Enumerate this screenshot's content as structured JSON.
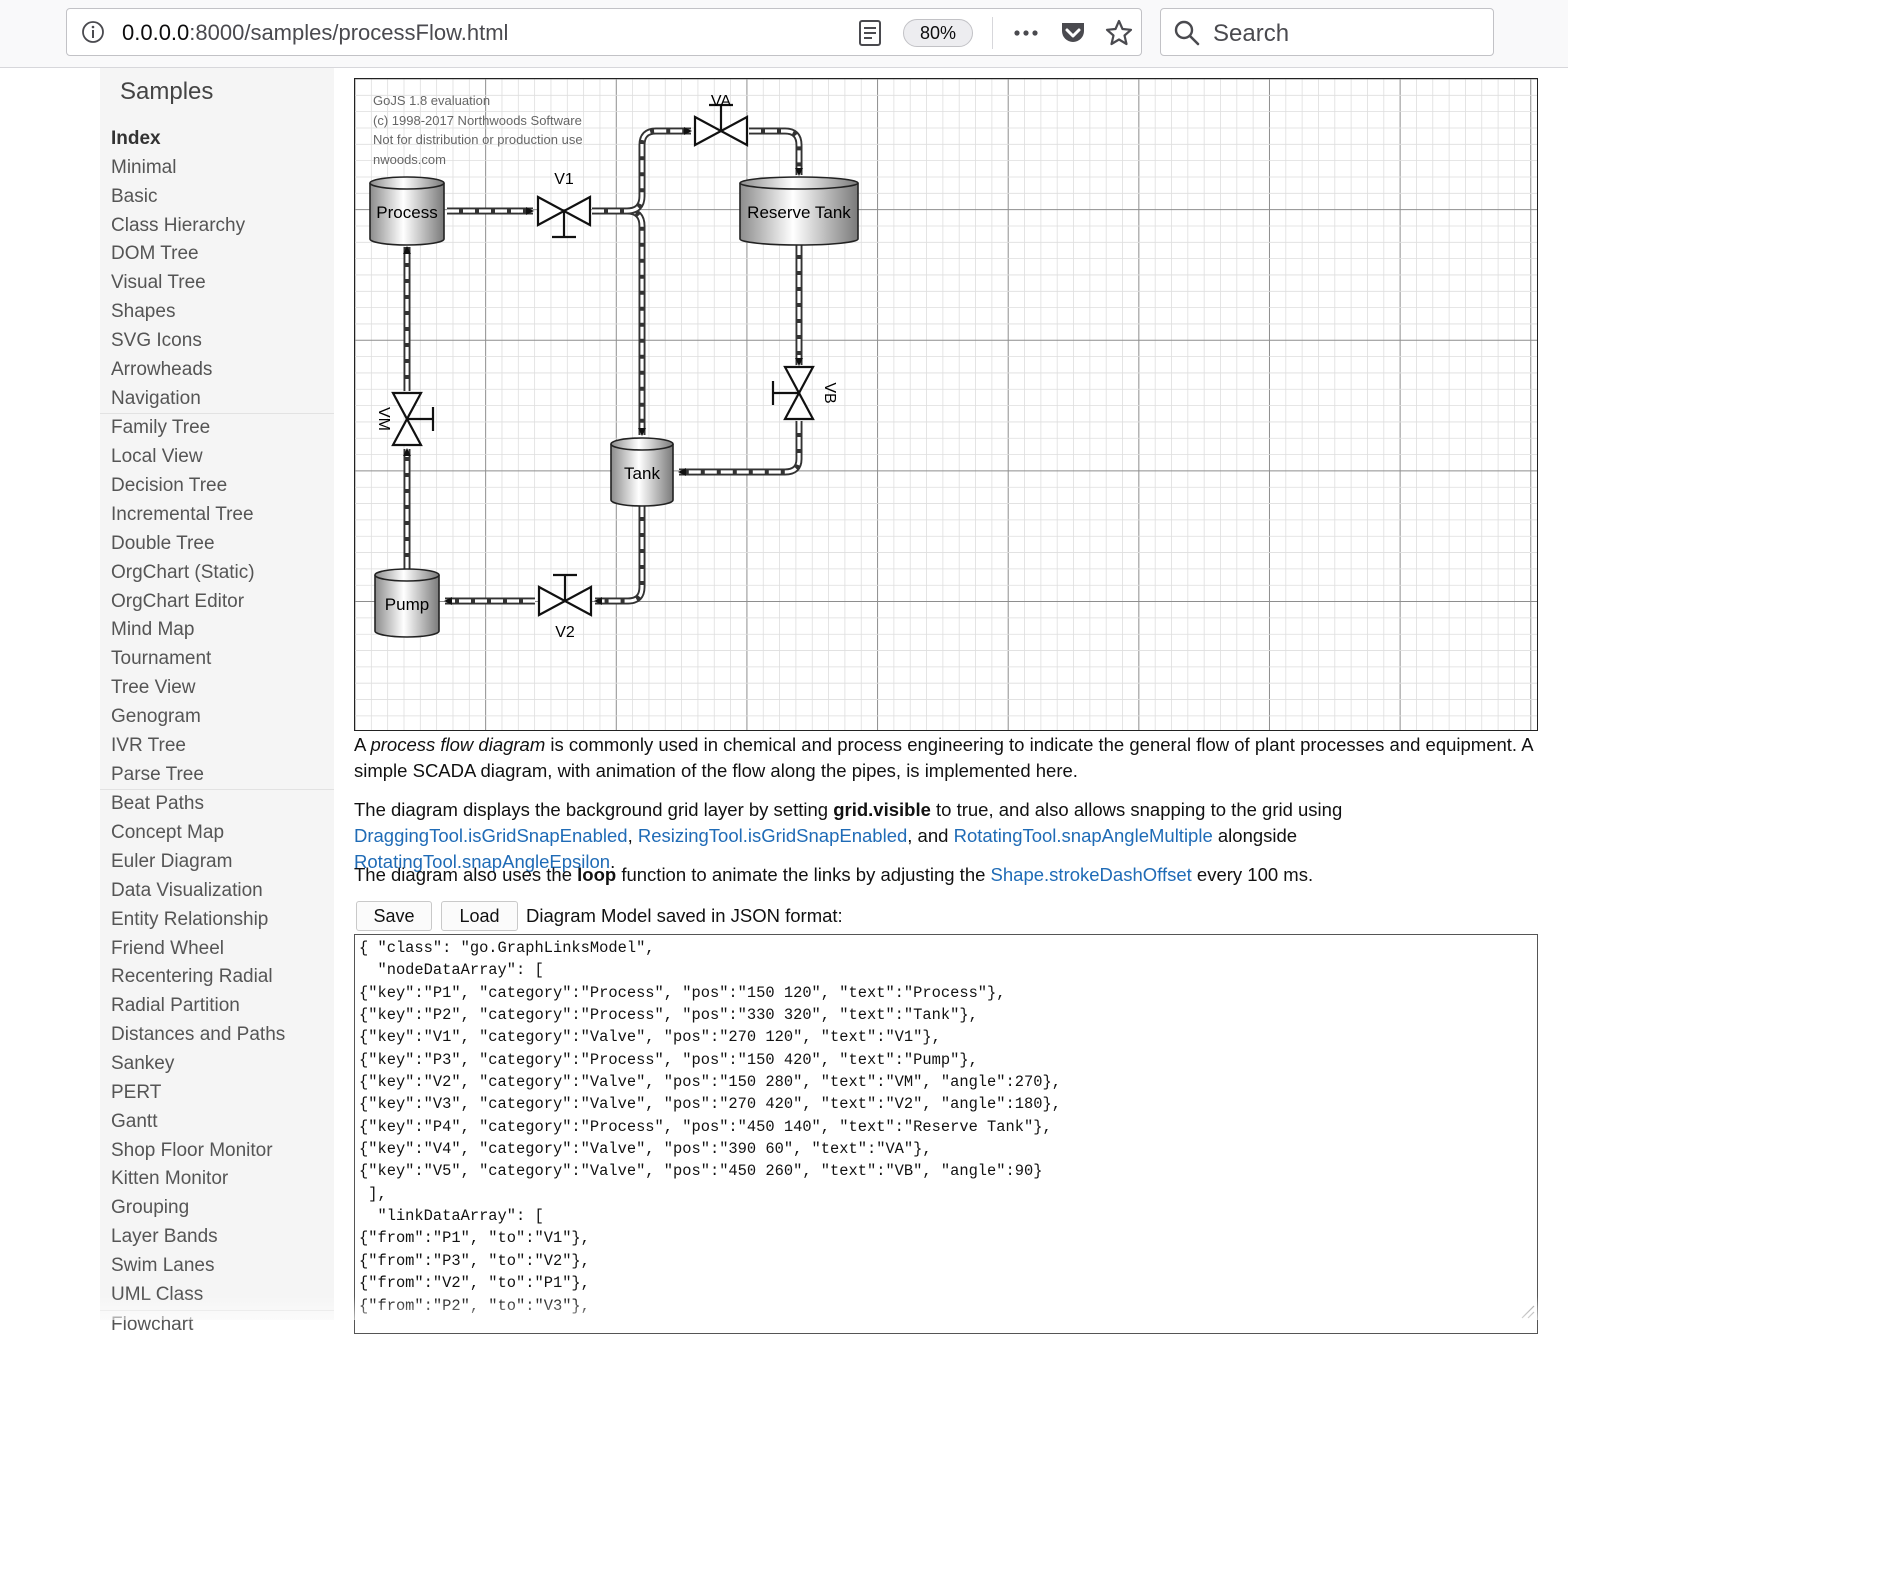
{
  "browser": {
    "url_host": "0.0.0.0",
    "url_path": ":8000/samples/processFlow.html",
    "zoom": "80%",
    "search_placeholder": "Search"
  },
  "sidebar": {
    "title": "Samples",
    "items": [
      {
        "label": "Index",
        "active": true
      },
      {
        "label": "Minimal"
      },
      {
        "label": "Basic"
      },
      {
        "label": "Class Hierarchy"
      },
      {
        "label": "DOM Tree"
      },
      {
        "label": "Visual Tree"
      },
      {
        "label": "Shapes"
      },
      {
        "label": "SVG Icons"
      },
      {
        "label": "Arrowheads"
      },
      {
        "label": "Navigation"
      },
      {
        "label": "Family Tree",
        "separator": true
      },
      {
        "label": "Local View"
      },
      {
        "label": "Decision Tree"
      },
      {
        "label": "Incremental Tree"
      },
      {
        "label": "Double Tree"
      },
      {
        "label": "OrgChart (Static)"
      },
      {
        "label": "OrgChart Editor"
      },
      {
        "label": "Mind Map"
      },
      {
        "label": "Tournament"
      },
      {
        "label": "Tree View"
      },
      {
        "label": "Genogram"
      },
      {
        "label": "IVR Tree"
      },
      {
        "label": "Parse Tree"
      },
      {
        "label": "Beat Paths",
        "separator": true
      },
      {
        "label": "Concept Map"
      },
      {
        "label": "Euler Diagram"
      },
      {
        "label": "Data Visualization"
      },
      {
        "label": "Entity Relationship"
      },
      {
        "label": "Friend Wheel"
      },
      {
        "label": "Recentering Radial"
      },
      {
        "label": "Radial Partition"
      },
      {
        "label": "Distances and Paths"
      },
      {
        "label": "Sankey"
      },
      {
        "label": "PERT"
      },
      {
        "label": "Gantt"
      },
      {
        "label": "Shop Floor Monitor"
      },
      {
        "label": "Kitten Monitor"
      },
      {
        "label": "Grouping"
      },
      {
        "label": "Layer Bands"
      },
      {
        "label": "Swim Lanes"
      },
      {
        "label": "UML Class"
      },
      {
        "label": "Flowchart",
        "separator": true
      }
    ]
  },
  "diagram": {
    "watermark": [
      "GoJS 1.8 evaluation",
      "(c) 1998-2017 Northwoods Software",
      "Not for distribution or production use",
      "nwoods.com"
    ],
    "nodes": {
      "process": "Process",
      "reserve_tank": "Reserve Tank",
      "tank": "Tank",
      "pump": "Pump",
      "v1": "V1",
      "v2": "V2",
      "va": "VA",
      "vb": "VB",
      "vm": "VM"
    }
  },
  "description": {
    "p1_a": "A ",
    "p1_italic": "process flow diagram",
    "p1_b": " is commonly used in chemical and process engineering to indicate the general flow of plant processes and equipment. A simple SCADA diagram, with animation of the flow along the pipes, is implemented here.",
    "p2_a": "The diagram displays the background grid layer by setting ",
    "p2_bold": "grid.visible",
    "p2_b": " to true, and also allows snapping to the grid using",
    "p2_link1": "DraggingTool.isGridSnapEnabled",
    "p2_c": ", ",
    "p2_link2": "ResizingTool.isGridSnapEnabled",
    "p2_d": ", and ",
    "p2_link3": "RotatingTool.snapAngleMultiple",
    "p2_e": " alongside ",
    "p2_link4": "RotatingTool.snapAngleEpsilon",
    "p2_f": ".",
    "p3_a": "The diagram also uses the ",
    "p3_bold": "loop",
    "p3_b": " function to animate the links by adjusting the ",
    "p3_link": "Shape.strokeDashOffset",
    "p3_c": " every 100 ms."
  },
  "controls": {
    "save_label": "Save",
    "load_label": "Load",
    "json_label": "Diagram Model saved in JSON format:"
  },
  "json_text": [
    "{ \"class\": \"go.GraphLinksModel\",",
    "  \"nodeDataArray\": [",
    "{\"key\":\"P1\", \"category\":\"Process\", \"pos\":\"150 120\", \"text\":\"Process\"},",
    "{\"key\":\"P2\", \"category\":\"Process\", \"pos\":\"330 320\", \"text\":\"Tank\"},",
    "{\"key\":\"V1\", \"category\":\"Valve\", \"pos\":\"270 120\", \"text\":\"V1\"},",
    "{\"key\":\"P3\", \"category\":\"Process\", \"pos\":\"150 420\", \"text\":\"Pump\"},",
    "{\"key\":\"V2\", \"category\":\"Valve\", \"pos\":\"150 280\", \"text\":\"VM\", \"angle\":270},",
    "{\"key\":\"V3\", \"category\":\"Valve\", \"pos\":\"270 420\", \"text\":\"V2\", \"angle\":180},",
    "{\"key\":\"P4\", \"category\":\"Process\", \"pos\":\"450 140\", \"text\":\"Reserve Tank\"},",
    "{\"key\":\"V4\", \"category\":\"Valve\", \"pos\":\"390 60\", \"text\":\"VA\"},",
    "{\"key\":\"V5\", \"category\":\"Valve\", \"pos\":\"450 260\", \"text\":\"VB\", \"angle\":90}",
    " ],",
    "  \"linkDataArray\": [",
    "{\"from\":\"P1\", \"to\":\"V1\"},",
    "{\"from\":\"P3\", \"to\":\"V2\"},",
    "{\"from\":\"V2\", \"to\":\"P1\"},",
    "{\"from\":\"P2\", \"to\":\"V3\"},"
  ]
}
